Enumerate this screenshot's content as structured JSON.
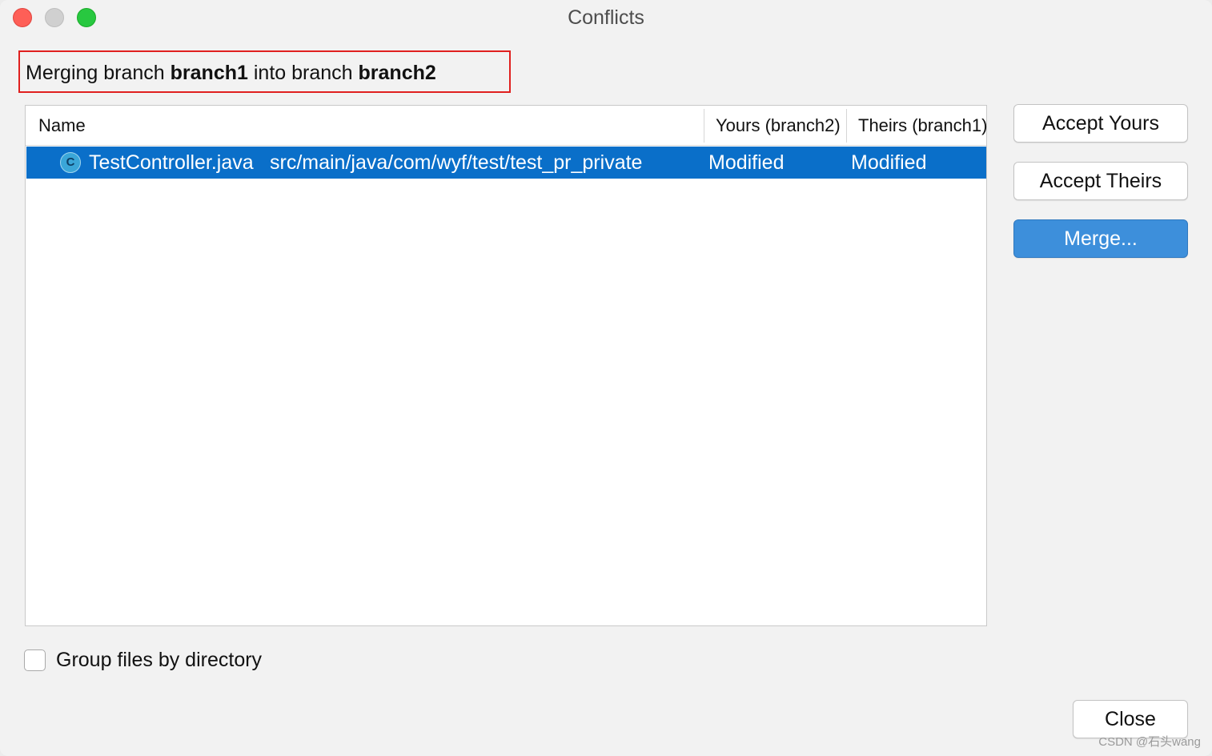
{
  "window": {
    "title": "Conflicts"
  },
  "merge_info": {
    "prefix": "Merging branch ",
    "source_branch": "branch1",
    "middle": " into branch ",
    "target_branch": "branch2"
  },
  "table": {
    "columns": {
      "name": "Name",
      "yours": "Yours (branch2)",
      "theirs": "Theirs (branch1)"
    },
    "rows": [
      {
        "icon_letter": "C",
        "icon": "java-class-icon",
        "file_name": "TestController.java",
        "path": "src/main/java/com/wyf/test/test_pr_private",
        "yours": "Modified",
        "theirs": "Modified",
        "selected": true
      }
    ]
  },
  "actions": {
    "accept_yours": "Accept Yours",
    "accept_theirs": "Accept Theirs",
    "merge": "Merge..."
  },
  "options": {
    "group_by_directory_label": "Group files by directory",
    "group_by_directory_checked": false
  },
  "footer": {
    "close": "Close"
  },
  "watermark": "CSDN @石头wang",
  "colors": {
    "selection": "#0a6fc9",
    "primary_button": "#3d8fdb",
    "highlight_border": "#e0201f"
  }
}
